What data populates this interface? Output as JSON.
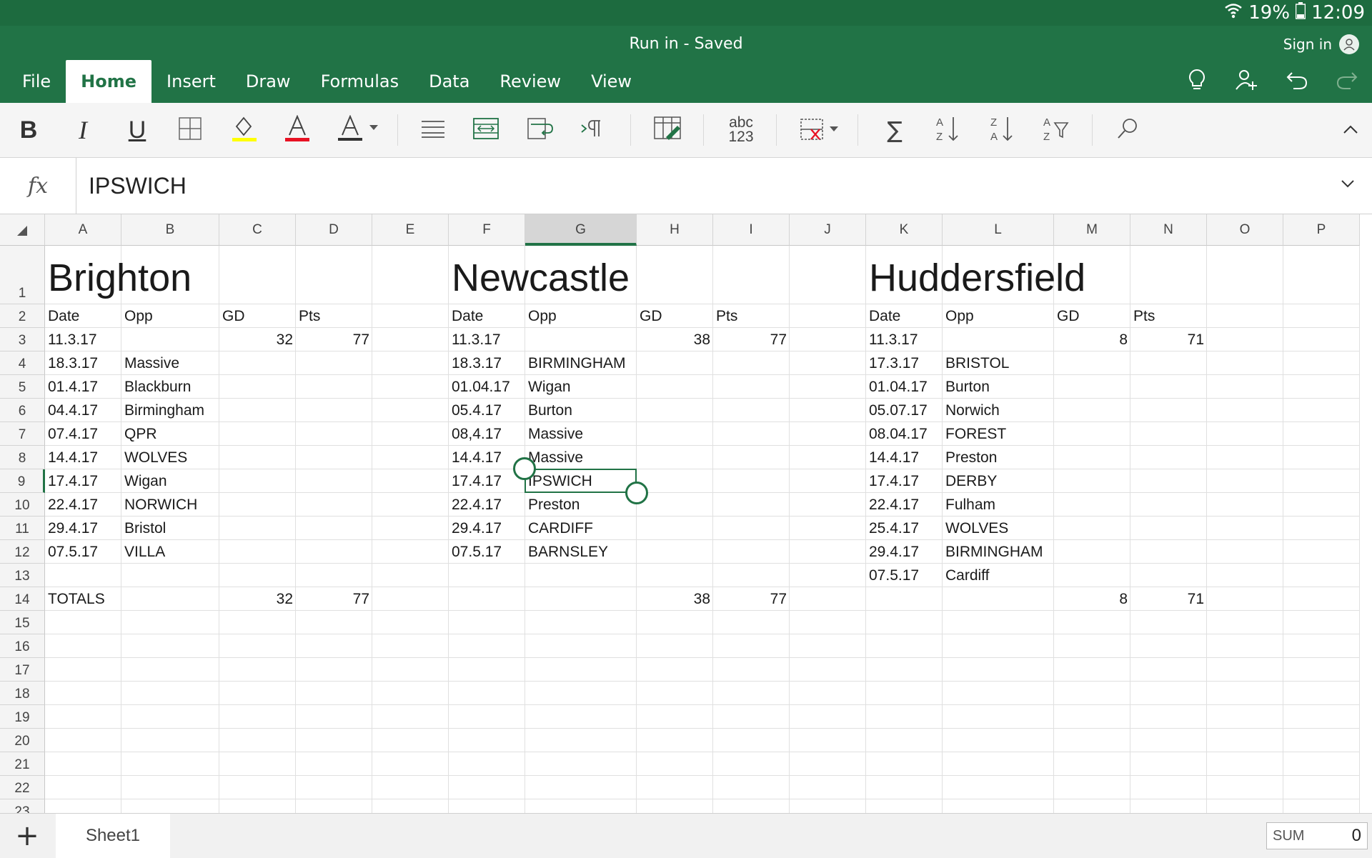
{
  "status": {
    "battery_pct": "19%",
    "time": "12:09"
  },
  "title": "Run in - Saved",
  "signin": "Sign in",
  "tabs": [
    "File",
    "Home",
    "Insert",
    "Draw",
    "Formulas",
    "Data",
    "Review",
    "View"
  ],
  "active_tab": "Home",
  "toolbar": {
    "bold": "B",
    "italic": "I",
    "underline": "U",
    "number_format": "abc\n123"
  },
  "colors": {
    "brand": "#217346",
    "highlight": "#ffff00",
    "font_color": "#e81123"
  },
  "formula_bar": {
    "label": "fx",
    "value": "IPSWICH"
  },
  "columns": [
    "A",
    "B",
    "C",
    "D",
    "E",
    "F",
    "G",
    "H",
    "I",
    "J",
    "K",
    "L",
    "M",
    "N",
    "O",
    "P"
  ],
  "selected_column": "G",
  "selected_row": "9",
  "rows": [
    "1",
    "2",
    "3",
    "4",
    "5",
    "6",
    "7",
    "8",
    "9",
    "10",
    "11",
    "12",
    "13",
    "14",
    "15",
    "16",
    "17",
    "18",
    "19",
    "20",
    "21",
    "22",
    "23"
  ],
  "cells": [
    {
      "ref": "A1",
      "v": "Brighton"
    },
    {
      "ref": "F1",
      "v": "Newcastle"
    },
    {
      "ref": "K1",
      "v": "Huddersfield"
    },
    {
      "ref": "A2",
      "v": "Date"
    },
    {
      "ref": "B2",
      "v": "Opp"
    },
    {
      "ref": "C2",
      "v": "GD"
    },
    {
      "ref": "D2",
      "v": "Pts"
    },
    {
      "ref": "F2",
      "v": "Date"
    },
    {
      "ref": "G2",
      "v": "Opp"
    },
    {
      "ref": "H2",
      "v": "GD"
    },
    {
      "ref": "I2",
      "v": "Pts"
    },
    {
      "ref": "K2",
      "v": "Date"
    },
    {
      "ref": "L2",
      "v": "Opp"
    },
    {
      "ref": "M2",
      "v": "GD"
    },
    {
      "ref": "N2",
      "v": "Pts"
    },
    {
      "ref": "A3",
      "v": "11.3.17"
    },
    {
      "ref": "C3",
      "v": "32",
      "num": true
    },
    {
      "ref": "D3",
      "v": "77",
      "num": true
    },
    {
      "ref": "F3",
      "v": "11.3.17"
    },
    {
      "ref": "H3",
      "v": "38",
      "num": true
    },
    {
      "ref": "I3",
      "v": "77",
      "num": true
    },
    {
      "ref": "K3",
      "v": "11.3.17"
    },
    {
      "ref": "M3",
      "v": "8",
      "num": true
    },
    {
      "ref": "N3",
      "v": "71",
      "num": true
    },
    {
      "ref": "A4",
      "v": "18.3.17"
    },
    {
      "ref": "B4",
      "v": "Massive"
    },
    {
      "ref": "F4",
      "v": "18.3.17"
    },
    {
      "ref": "G4",
      "v": "BIRMINGHAM"
    },
    {
      "ref": "K4",
      "v": "17.3.17"
    },
    {
      "ref": "L4",
      "v": "BRISTOL"
    },
    {
      "ref": "A5",
      "v": "01.4.17"
    },
    {
      "ref": "B5",
      "v": "Blackburn"
    },
    {
      "ref": "F5",
      "v": "01.04.17"
    },
    {
      "ref": "G5",
      "v": "Wigan"
    },
    {
      "ref": "K5",
      "v": "01.04.17"
    },
    {
      "ref": "L5",
      "v": "Burton"
    },
    {
      "ref": "A6",
      "v": "04.4.17"
    },
    {
      "ref": "B6",
      "v": "Birmingham"
    },
    {
      "ref": "F6",
      "v": "05.4.17"
    },
    {
      "ref": "G6",
      "v": "Burton"
    },
    {
      "ref": "K6",
      "v": "05.07.17"
    },
    {
      "ref": "L6",
      "v": "Norwich"
    },
    {
      "ref": "A7",
      "v": "07.4.17"
    },
    {
      "ref": "B7",
      "v": "QPR"
    },
    {
      "ref": "F7",
      "v": "08,4.17"
    },
    {
      "ref": "G7",
      "v": "Massive"
    },
    {
      "ref": "K7",
      "v": "08.04.17"
    },
    {
      "ref": "L7",
      "v": "FOREST"
    },
    {
      "ref": "A8",
      "v": "14.4.17"
    },
    {
      "ref": "B8",
      "v": "WOLVES"
    },
    {
      "ref": "F8",
      "v": "14.4.17"
    },
    {
      "ref": "G8",
      "v": "Massive"
    },
    {
      "ref": "K8",
      "v": "14.4.17"
    },
    {
      "ref": "L8",
      "v": "Preston"
    },
    {
      "ref": "A9",
      "v": "17.4.17"
    },
    {
      "ref": "B9",
      "v": "Wigan"
    },
    {
      "ref": "F9",
      "v": "17.4.17"
    },
    {
      "ref": "G9",
      "v": "IPSWICH"
    },
    {
      "ref": "K9",
      "v": "17.4.17"
    },
    {
      "ref": "L9",
      "v": "DERBY"
    },
    {
      "ref": "A10",
      "v": "22.4.17"
    },
    {
      "ref": "B10",
      "v": "NORWICH"
    },
    {
      "ref": "F10",
      "v": "22.4.17"
    },
    {
      "ref": "G10",
      "v": "Preston"
    },
    {
      "ref": "K10",
      "v": "22.4.17"
    },
    {
      "ref": "L10",
      "v": "Fulham"
    },
    {
      "ref": "A11",
      "v": "29.4.17"
    },
    {
      "ref": "B11",
      "v": "Bristol"
    },
    {
      "ref": "F11",
      "v": "29.4.17"
    },
    {
      "ref": "G11",
      "v": "CARDIFF"
    },
    {
      "ref": "K11",
      "v": "25.4.17"
    },
    {
      "ref": "L11",
      "v": "WOLVES"
    },
    {
      "ref": "A12",
      "v": "07.5.17"
    },
    {
      "ref": "B12",
      "v": "VILLA"
    },
    {
      "ref": "F12",
      "v": "07.5.17"
    },
    {
      "ref": "G12",
      "v": "BARNSLEY"
    },
    {
      "ref": "K12",
      "v": "29.4.17"
    },
    {
      "ref": "L12",
      "v": "BIRMINGHAM"
    },
    {
      "ref": "K13",
      "v": "07.5.17"
    },
    {
      "ref": "L13",
      "v": "Cardiff"
    },
    {
      "ref": "A14",
      "v": "TOTALS"
    },
    {
      "ref": "C14",
      "v": "32",
      "num": true
    },
    {
      "ref": "D14",
      "v": "77",
      "num": true
    },
    {
      "ref": "H14",
      "v": "38",
      "num": true
    },
    {
      "ref": "I14",
      "v": "77",
      "num": true
    },
    {
      "ref": "M14",
      "v": "8",
      "num": true
    },
    {
      "ref": "N14",
      "v": "71",
      "num": true
    }
  ],
  "sheet": {
    "add": "+",
    "name": "Sheet1"
  },
  "sum": {
    "label": "SUM",
    "value": "0"
  }
}
